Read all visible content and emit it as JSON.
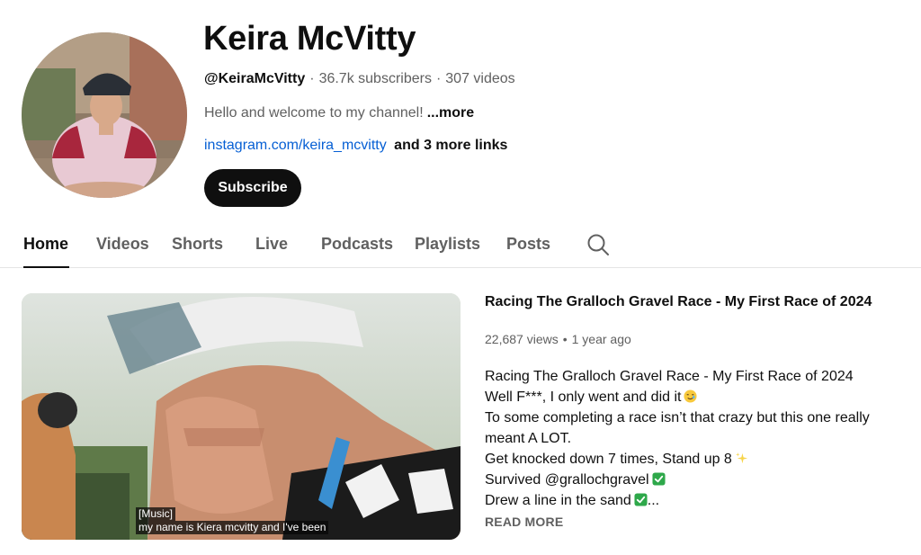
{
  "channel": {
    "name": "Keira McVitty",
    "handle": "@KeiraMcVitty",
    "subscribers": "36.7k subscribers",
    "videos": "307 videos",
    "separator": "·",
    "description": "Hello and welcome to my channel!",
    "description_more": "...more",
    "link": "instagram.com/keira_mcvitty",
    "more_links": "and 3 more links",
    "subscribe_label": "Subscribe"
  },
  "tabs": [
    {
      "label": "Home",
      "active": true
    },
    {
      "label": "Videos",
      "active": false
    },
    {
      "label": "Shorts",
      "active": false
    },
    {
      "label": "Live",
      "active": false
    },
    {
      "label": "Podcasts",
      "active": false
    },
    {
      "label": "Playlists",
      "active": false
    },
    {
      "label": "Posts",
      "active": false
    }
  ],
  "search_icon": "search-icon",
  "featured": {
    "title": "Racing The Gralloch Gravel Race - My First Race of 2024",
    "views": "22,687 views",
    "age": "1 year ago",
    "dot": "•",
    "caption_lines": [
      "[Music]",
      "my name is Kiera mcvitty and I've been"
    ],
    "description_lines": [
      {
        "text": "Racing The Gralloch Gravel Race - My First Race of 2024",
        "emoji": ""
      },
      {
        "text": "Well F***, I only went and did it",
        "emoji": "smiling-face-with-tear"
      },
      {
        "text": "To some completing a race isn’t that crazy but this one really",
        "emoji": ""
      },
      {
        "text": "meant A LOT.",
        "emoji": ""
      },
      {
        "text": "Get knocked down 7 times, Stand up 8",
        "emoji": "sparkles"
      },
      {
        "text": "Survived @grallochgravel",
        "emoji": "check-mark-button"
      },
      {
        "text": "Drew a line in the sand",
        "emoji": "check-mark-button",
        "suffix": "..."
      }
    ],
    "read_more": "READ MORE"
  },
  "colors": {
    "text_primary": "#0f0f0f",
    "text_secondary": "#606060",
    "link": "#065fd4",
    "subscribe_bg": "#0f0f0f",
    "check_green": "#2ea84a"
  }
}
